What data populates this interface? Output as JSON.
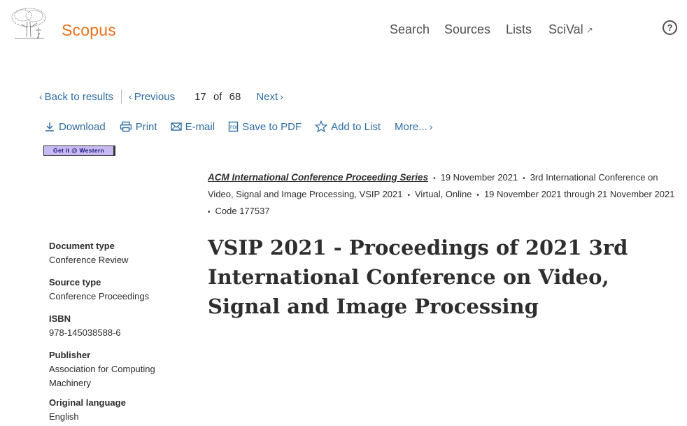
{
  "header": {
    "brand": "Scopus",
    "nav": {
      "search": "Search",
      "sources": "Sources",
      "lists": "Lists",
      "scival": "SciVal"
    },
    "help": "?"
  },
  "results_nav": {
    "back": "Back to results",
    "previous": "Previous",
    "current": "17",
    "of": "of",
    "total": "68",
    "next": "Next"
  },
  "actions": {
    "download": "Download",
    "print": "Print",
    "email": "E-mail",
    "save_pdf": "Save to PDF",
    "add_list": "Add to List",
    "more": "More..."
  },
  "getit": "Get it @ Western",
  "source": {
    "series": "ACM International Conference Proceeding Series",
    "date": "19 November 2021",
    "conference": "3rd International Conference on Video, Signal and Image Processing, VSIP 2021",
    "location": "Virtual, Online",
    "dates_range": "19 November 2021 through 21 November 2021",
    "code": "Code 177537"
  },
  "title": "VSIP 2021 - Proceedings of 2021 3rd International Conference on Video, Signal and Image Processing",
  "metadata": {
    "document_type": {
      "label": "Document type",
      "value": "Conference Review"
    },
    "source_type": {
      "label": "Source type",
      "value": "Conference Proceedings"
    },
    "isbn": {
      "label": "ISBN",
      "value": "978-145038588-6"
    },
    "publisher": {
      "label": "Publisher",
      "value_line1": "Association for Computing",
      "value_line2": "Machinery"
    },
    "language": {
      "label": "Original language",
      "value": "English"
    }
  },
  "colors": {
    "brand": "#e9711c",
    "link": "#2e6da4",
    "text": "#2e2e2e",
    "getit_bg": "#c9b9f2"
  },
  "icons": [
    "elsevier-tree-logo",
    "help-icon",
    "chevron-left-icon",
    "chevron-right-icon",
    "download-icon",
    "print-icon",
    "email-icon",
    "pdf-icon",
    "star-icon",
    "external-arrow-icon"
  ]
}
